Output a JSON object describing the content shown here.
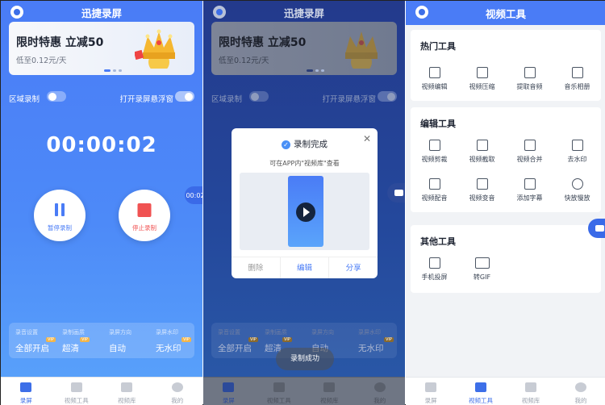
{
  "panel1": {
    "title": "迅捷录屏",
    "banner": {
      "title": "限时特惠  立减50",
      "subtitle": "低至0.12元/天"
    },
    "toggles": {
      "area_record": "区域录制",
      "float_window": "打开录屏悬浮窗"
    },
    "timer": "00:00:02",
    "pause_label": "暂停录制",
    "stop_label": "停止录制",
    "floater_time": "00:02",
    "settings": [
      {
        "caption": "录音设置",
        "value": "全部开启",
        "vip": "VIP"
      },
      {
        "caption": "录制画质",
        "value": "超清",
        "vip": "VIP"
      },
      {
        "caption": "录屏方向",
        "value": "自动",
        "vip": ""
      },
      {
        "caption": "录屏水印",
        "value": "无水印",
        "vip": "VIP"
      }
    ]
  },
  "panel2": {
    "modal": {
      "title": "录制完成",
      "subtitle": "可在APP内\"视频库\"查看",
      "actions": [
        "删除",
        "编辑",
        "分享"
      ]
    },
    "toast": "录制成功"
  },
  "panel3": {
    "title": "视频工具",
    "sections": [
      {
        "title": "热门工具",
        "tools": [
          "视频编辑",
          "视频压缩",
          "提取音频",
          "音乐相册"
        ]
      },
      {
        "title": "编辑工具",
        "tools": [
          "视频剪裁",
          "视频截取",
          "视频合并",
          "去水印",
          "视频配音",
          "视频变音",
          "添加字幕",
          "快放慢放"
        ]
      },
      {
        "title": "其他工具",
        "tools": [
          "手机投屏",
          "转GIF"
        ]
      }
    ]
  },
  "tabs": [
    "录屏",
    "视频工具",
    "视频库",
    "我的"
  ],
  "colors": {
    "accent": "#4a7cf6",
    "stop": "#f05252",
    "vip": "#f3b64b"
  }
}
